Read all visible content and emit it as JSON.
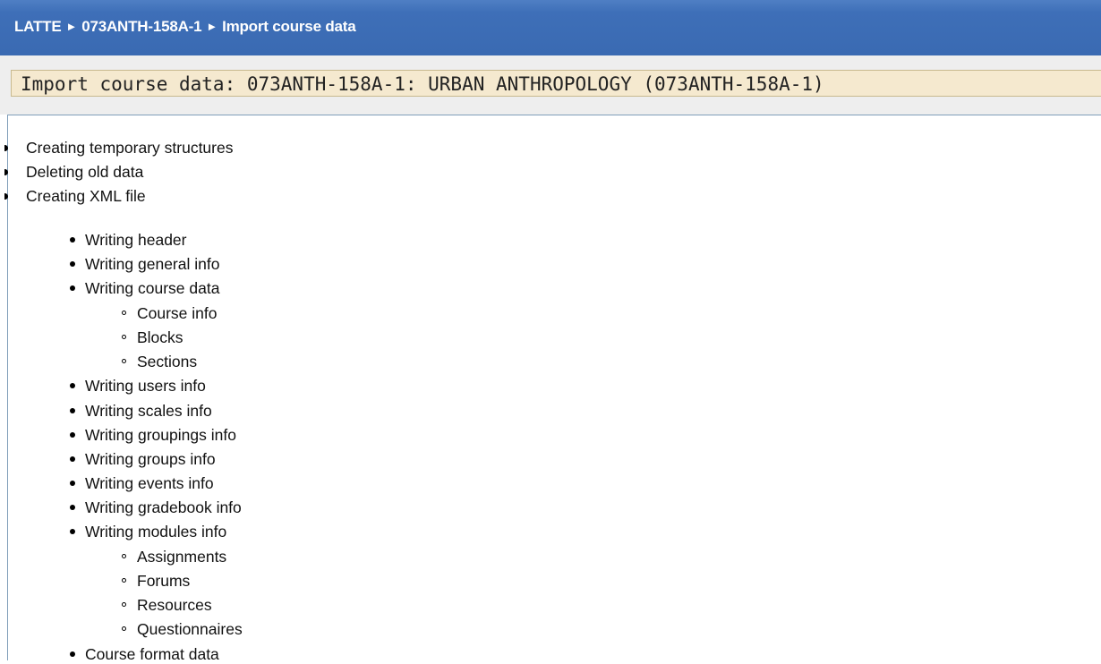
{
  "breadcrumb": {
    "home": "LATTE",
    "course": "073ANTH-158A-1",
    "current": "Import course data",
    "separator": "►"
  },
  "heading": {
    "title": "Import course data: 073ANTH-158A-1: URBAN ANTHROPOLOGY (073ANTH-158A-1)"
  },
  "progress": {
    "steps": [
      "Creating temporary structures",
      "Deleting old data",
      "Creating XML file"
    ],
    "xml_steps": [
      "Writing header",
      "Writing general info",
      "Writing course data",
      "Writing users info",
      "Writing scales info",
      "Writing groupings info",
      "Writing groups info",
      "Writing events info",
      "Writing gradebook info",
      "Writing modules info",
      "Course format data"
    ],
    "course_data_steps": [
      "Course info",
      "Blocks",
      "Sections"
    ],
    "modules_steps": [
      "Assignments",
      "Forums",
      "Resources",
      "Questionnaires"
    ]
  }
}
